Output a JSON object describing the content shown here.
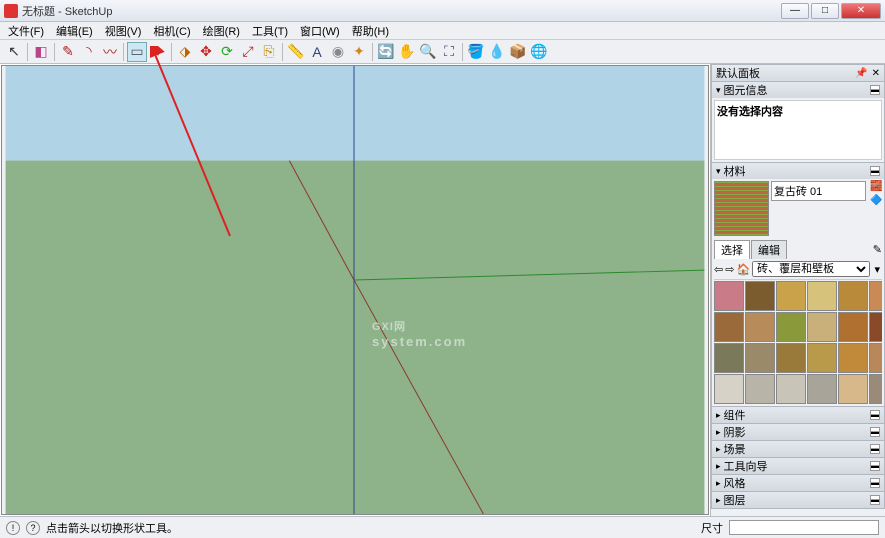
{
  "window": {
    "title": "无标题 - SketchUp"
  },
  "menu": [
    "文件(F)",
    "编辑(E)",
    "视图(V)",
    "相机(C)",
    "绘图(R)",
    "工具(T)",
    "窗口(W)",
    "帮助(H)"
  ],
  "toolbar": {
    "groups": [
      [
        "select"
      ],
      [
        "eraser"
      ],
      [
        "pencil",
        "arc",
        "freehand"
      ],
      [
        "rectangle",
        "dd"
      ],
      [
        "pushpull",
        "move",
        "rotate",
        "scale",
        "offset"
      ],
      [
        "tape",
        "text",
        "protractor",
        "axes"
      ],
      [
        "orbit",
        "pan",
        "zoom",
        "zoomext"
      ],
      [
        "paint",
        "sample",
        "components",
        "3dw"
      ]
    ],
    "icons": {
      "select": "↖",
      "eraser": "◧",
      "pencil": "✎",
      "arc": "◝",
      "freehand": "〰",
      "rectangle": "▭",
      "dd": "▾",
      "pushpull": "⬗",
      "move": "✥",
      "rotate": "⟳",
      "scale": "⤢",
      "offset": "⎘",
      "tape": "📏",
      "text": "A",
      "protractor": "◉",
      "axes": "✦",
      "orbit": "🔄",
      "pan": "✋",
      "zoom": "🔍",
      "zoomext": "⛶",
      "paint": "🪣",
      "sample": "💧",
      "components": "📦",
      "3dw": "🌐"
    },
    "colors": {
      "select": "#333",
      "eraser": "#b48",
      "pencil": "#a22",
      "arc": "#a22",
      "freehand": "#a22",
      "rectangle": "#555",
      "dd": "#333",
      "pushpull": "#b60",
      "move": "#c22",
      "rotate": "#2a2",
      "scale": "#b22",
      "offset": "#b80",
      "tape": "#999",
      "text": "#347",
      "protractor": "#888",
      "axes": "#c82",
      "orbit": "#2a2",
      "pan": "#c82",
      "zoom": "#347",
      "zoomext": "#347",
      "paint": "#c33",
      "sample": "#c82",
      "components": "#b60",
      "3dw": "#b33"
    },
    "selected": "rectangle"
  },
  "right": {
    "panel_title": "默认面板",
    "sections": {
      "entity": {
        "label": "图元信息",
        "content": "没有选择内容"
      },
      "materials": {
        "label": "材料",
        "current": "复古砖 01",
        "tabs": {
          "select": "选择",
          "edit": "编辑"
        },
        "dropdown": "砖、覆层和壁板",
        "swatches_colors": [
          "#c97b88",
          "#7a5c2f",
          "#c9a24a",
          "#d6c27a",
          "#b88a3a",
          "#c98a55",
          "#9a6a3a",
          "#b88c5a",
          "#8a9a3a",
          "#c9b07a",
          "#b07030",
          "#8a4a2a",
          "#7a7a5a",
          "#9a8a6a",
          "#9a7a3a",
          "#b89a4a",
          "#c08a3a",
          "#b8885a",
          "#d6d2c8",
          "#b8b4a8",
          "#c8c4b8",
          "#a8a49a",
          "#d6b88a",
          "#9a8a7a"
        ]
      },
      "collapsed": [
        "组件",
        "阴影",
        "场景",
        "工具向导",
        "风格",
        "图层"
      ]
    }
  },
  "status": {
    "hint": "点击箭头以切换形状工具。",
    "dim_label": "尺寸"
  },
  "watermark": {
    "main": "GXI网",
    "sub": "system.com"
  }
}
